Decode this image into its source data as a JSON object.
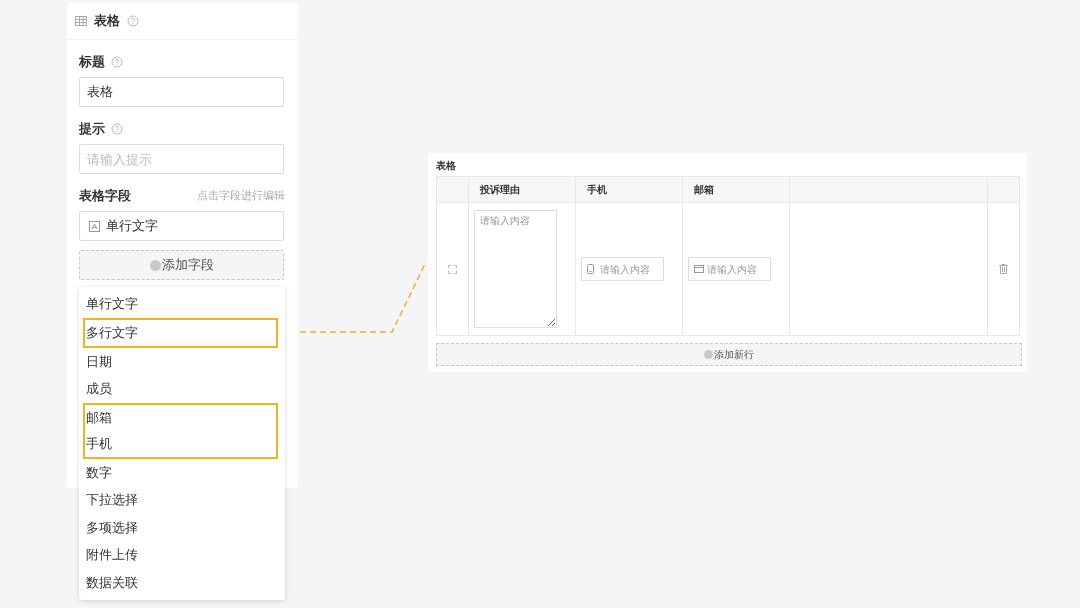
{
  "panel": {
    "title": "表格",
    "title_field": {
      "label": "标题",
      "value": "表格"
    },
    "hint_field": {
      "label": "提示",
      "placeholder": "请输入提示"
    },
    "columns_section": {
      "label": "表格字段",
      "note": "点击字段进行编辑",
      "fields": [
        "单行文字"
      ],
      "add_button": "添加字段"
    }
  },
  "dropdown": {
    "items": [
      {
        "label": "单行文字",
        "highlighted": false
      },
      {
        "label": "多行文字",
        "highlighted": true
      },
      {
        "label": "日期",
        "highlighted": false
      },
      {
        "label": "成员",
        "highlighted": false
      },
      {
        "label": "邮箱",
        "highlighted": true
      },
      {
        "label": "手机",
        "highlighted": true
      },
      {
        "label": "数字",
        "highlighted": false
      },
      {
        "label": "下拉选择",
        "highlighted": false
      },
      {
        "label": "多项选择",
        "highlighted": false
      },
      {
        "label": "附件上传",
        "highlighted": false
      },
      {
        "label": "数据关联",
        "highlighted": false
      }
    ]
  },
  "preview": {
    "title": "表格",
    "columns": [
      {
        "label": "投诉理由",
        "kind": "textarea",
        "placeholder": "请输入内容"
      },
      {
        "label": "手机",
        "kind": "phone",
        "placeholder": "请输入内容"
      },
      {
        "label": "邮箱",
        "kind": "email",
        "placeholder": "请输入内容"
      }
    ],
    "add_row_button": "添加新行"
  }
}
